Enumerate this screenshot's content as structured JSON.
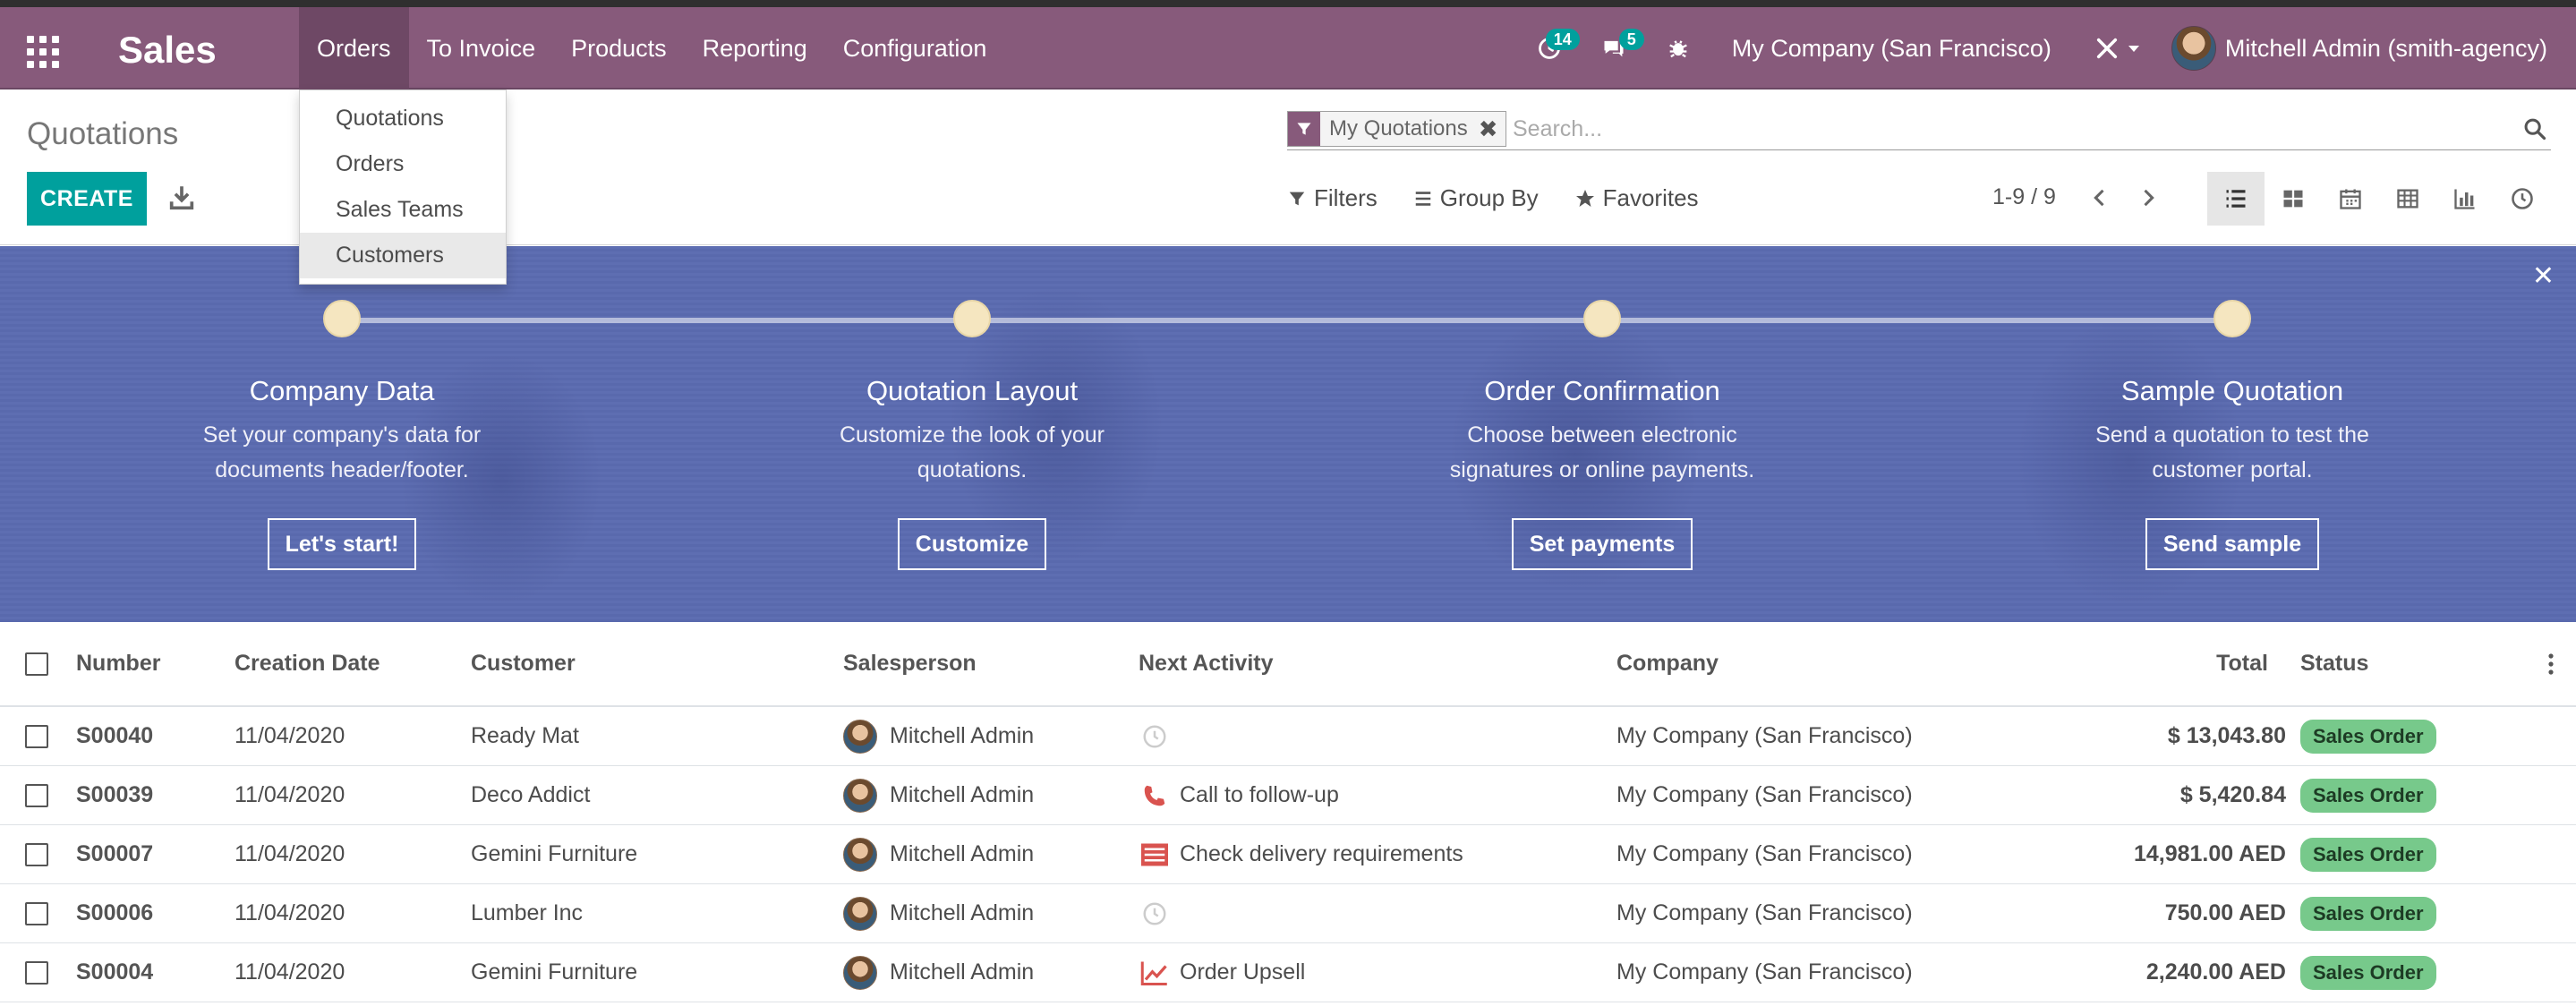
{
  "navbar": {
    "brand": "Sales",
    "menu": [
      "Orders",
      "To Invoice",
      "Products",
      "Reporting",
      "Configuration"
    ],
    "activity_count": "14",
    "messages_count": "5",
    "company": "My Company (San Francisco)",
    "user": "Mitchell Admin (smith-agency)",
    "color": "#875a7b"
  },
  "orders_dropdown": [
    "Quotations",
    "Orders",
    "Sales Teams",
    "Customers"
  ],
  "control_panel": {
    "title": "Quotations",
    "create_label": "CREATE",
    "facet_label": "My Quotations",
    "search_placeholder": "Search...",
    "filters_label": "Filters",
    "groupby_label": "Group By",
    "favorites_label": "Favorites",
    "pager": "1-9 / 9",
    "views": [
      "list-icon",
      "kanban-icon",
      "calendar-icon",
      "pivot-icon",
      "graph-icon",
      "activity-icon"
    ]
  },
  "banner": {
    "color": "#5b6bb0",
    "steps": [
      {
        "title": "Company Data",
        "desc1": "Set your company's data for",
        "desc2": "documents header/footer.",
        "button": "Let's start!"
      },
      {
        "title": "Quotation Layout",
        "desc1": "Customize the look of your",
        "desc2": "quotations.",
        "button": "Customize"
      },
      {
        "title": "Order Confirmation",
        "desc1": "Choose between electronic",
        "desc2": "signatures or online payments.",
        "button": "Set payments"
      },
      {
        "title": "Sample Quotation",
        "desc1": "Send a quotation to test the",
        "desc2": "customer portal.",
        "button": "Send sample"
      }
    ]
  },
  "table": {
    "headers": {
      "number": "Number",
      "date": "Creation Date",
      "customer": "Customer",
      "salesperson": "Salesperson",
      "activity": "Next Activity",
      "company": "Company",
      "total": "Total",
      "status": "Status"
    },
    "rows": [
      {
        "number": "S00040",
        "date": "11/04/2020",
        "customer": "Ready Mat",
        "salesperson": "Mitchell Admin",
        "activity": "",
        "activity_icon": "clock-icon",
        "company": "My Company (San Francisco)",
        "total": "$ 13,043.80",
        "status": "Sales Order"
      },
      {
        "number": "S00039",
        "date": "11/04/2020",
        "customer": "Deco Addict",
        "salesperson": "Mitchell Admin",
        "activity": "Call to follow-up",
        "activity_icon": "phone-icon",
        "company": "My Company (San Francisco)",
        "total": "$ 5,420.84",
        "status": "Sales Order"
      },
      {
        "number": "S00007",
        "date": "11/04/2020",
        "customer": "Gemini Furniture",
        "salesperson": "Mitchell Admin",
        "activity": "Check delivery requirements",
        "activity_icon": "tasks-icon",
        "company": "My Company (San Francisco)",
        "total": "14,981.00 AED",
        "status": "Sales Order"
      },
      {
        "number": "S00006",
        "date": "11/04/2020",
        "customer": "Lumber Inc",
        "salesperson": "Mitchell Admin",
        "activity": "",
        "activity_icon": "clock-icon",
        "company": "My Company (San Francisco)",
        "total": "750.00 AED",
        "status": "Sales Order"
      },
      {
        "number": "S00004",
        "date": "11/04/2020",
        "customer": "Gemini Furniture",
        "salesperson": "Mitchell Admin",
        "activity": "Order Upsell",
        "activity_icon": "chart-line-icon",
        "company": "My Company (San Francisco)",
        "total": "2,240.00 AED",
        "status": "Sales Order"
      }
    ],
    "status_color": "#77c98b"
  }
}
